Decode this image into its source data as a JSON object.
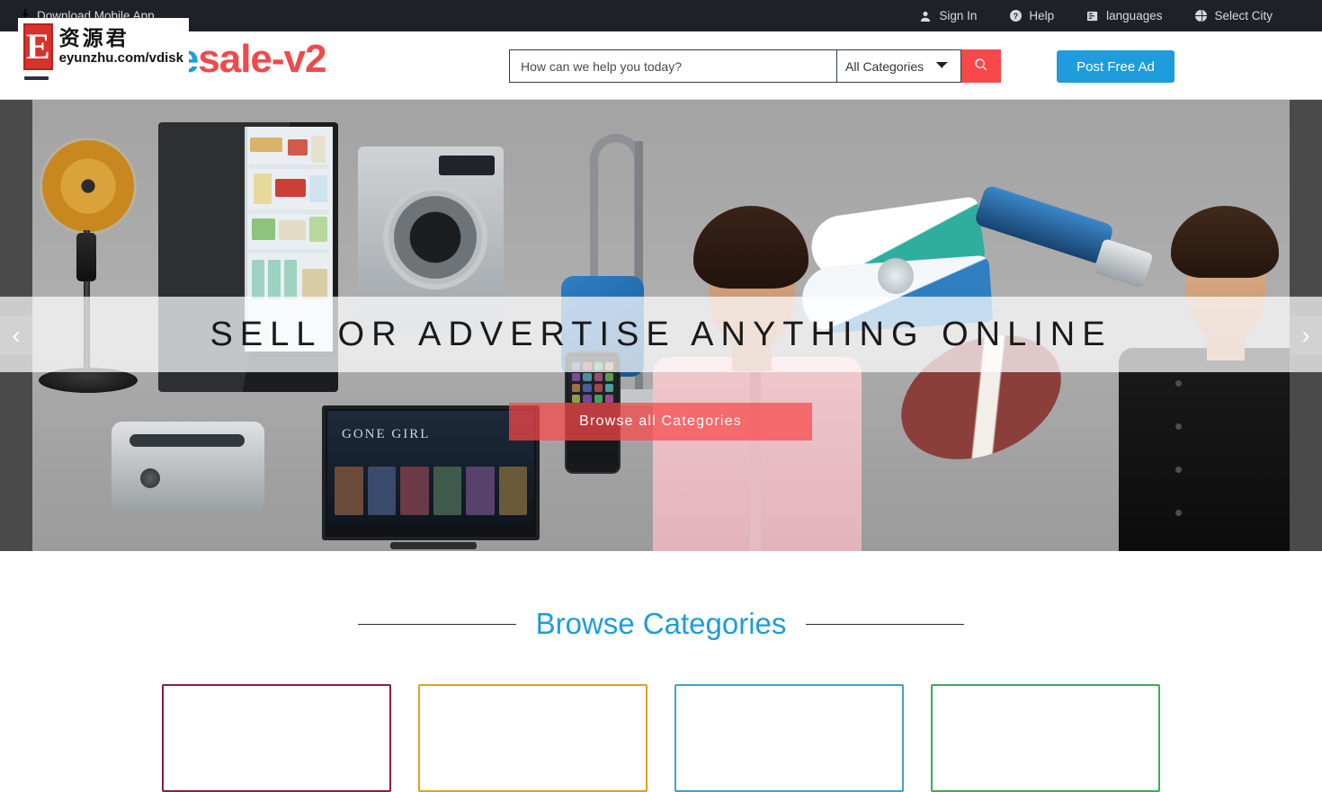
{
  "topbar": {
    "download_app": "Download Mobile App",
    "items": [
      {
        "label": "Sign In",
        "icon": "user-icon"
      },
      {
        "label": "Help",
        "icon": "question-circle-icon"
      },
      {
        "label": "languages",
        "icon": "language-icon"
      },
      {
        "label": "Select City",
        "icon": "globe-icon"
      }
    ]
  },
  "header": {
    "brand_first": "Re",
    "brand_second": "sale-v2",
    "brand_color_first": "#1e9cdc",
    "brand_color_second": "#ef4a4a",
    "menu_icon": "hamburger-icon"
  },
  "search": {
    "placeholder": "How can we help you today?",
    "value": "",
    "category_selected": "All Categories",
    "category_options": [
      "All Categories"
    ],
    "button_icon": "search-icon",
    "button_color": "#f9484a"
  },
  "post_ad": {
    "label": "Post Free Ad",
    "color": "#1e9cdc"
  },
  "hero": {
    "title": "SELL OR ADVERTISE ANYTHING ONLINE",
    "cta_label": "Browse all Categories",
    "cta_color": "#f9484a",
    "prev_arrow": "‹",
    "next_arrow": "›",
    "tv_title": "GONE GIRL"
  },
  "categories_section": {
    "title": "Browse Categories",
    "title_color": "#1e9cdc",
    "cards": [
      {
        "border_color": "#8e1b3f"
      },
      {
        "border_color": "#e0a021"
      },
      {
        "border_color": "#3ba3d0"
      },
      {
        "border_color": "#3cab5a"
      }
    ]
  },
  "watermark": {
    "logo_letter": "E",
    "cn_text": "资源君",
    "url": "eyunzhu.com/vdisk"
  }
}
